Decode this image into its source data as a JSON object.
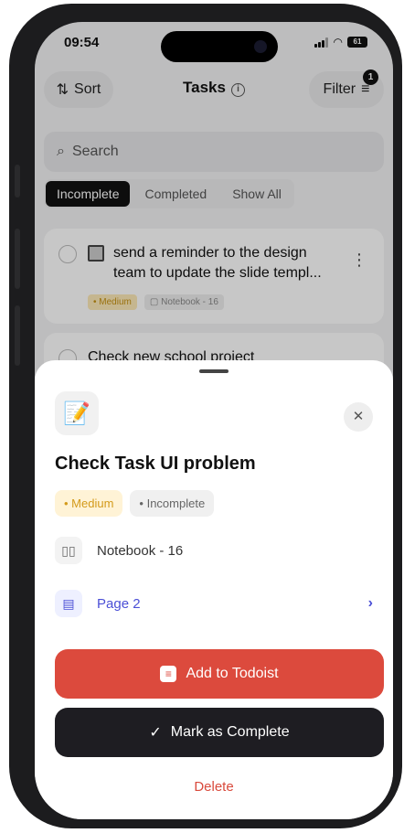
{
  "status": {
    "time": "09:54",
    "battery": "61"
  },
  "header": {
    "sort_label": "Sort",
    "title": "Tasks",
    "filter_label": "Filter",
    "filter_count": "1"
  },
  "search": {
    "placeholder": "Search"
  },
  "tabs": [
    {
      "label": "Incomplete",
      "active": true
    },
    {
      "label": "Completed",
      "active": false
    },
    {
      "label": "Show All",
      "active": false
    }
  ],
  "tasks": [
    {
      "text": "send a reminder to the design team to update the slide templ...",
      "priority": "Medium",
      "notebook": "Notebook - 16"
    },
    {
      "text": "Check new school project"
    }
  ],
  "sheet": {
    "emoji": "📝",
    "title": "Check Task UI problem",
    "priority": "Medium",
    "status": "Incomplete",
    "notebook": "Notebook - 16",
    "page": "Page 2",
    "todoist_label": "Add to Todoist",
    "complete_label": "Mark as Complete",
    "delete_label": "Delete"
  },
  "colors": {
    "todoist_red": "#dc4a3d",
    "dark_button": "#1e1d22",
    "page_blue": "#4b4fd6",
    "medium_amber": "#d39a1a"
  }
}
